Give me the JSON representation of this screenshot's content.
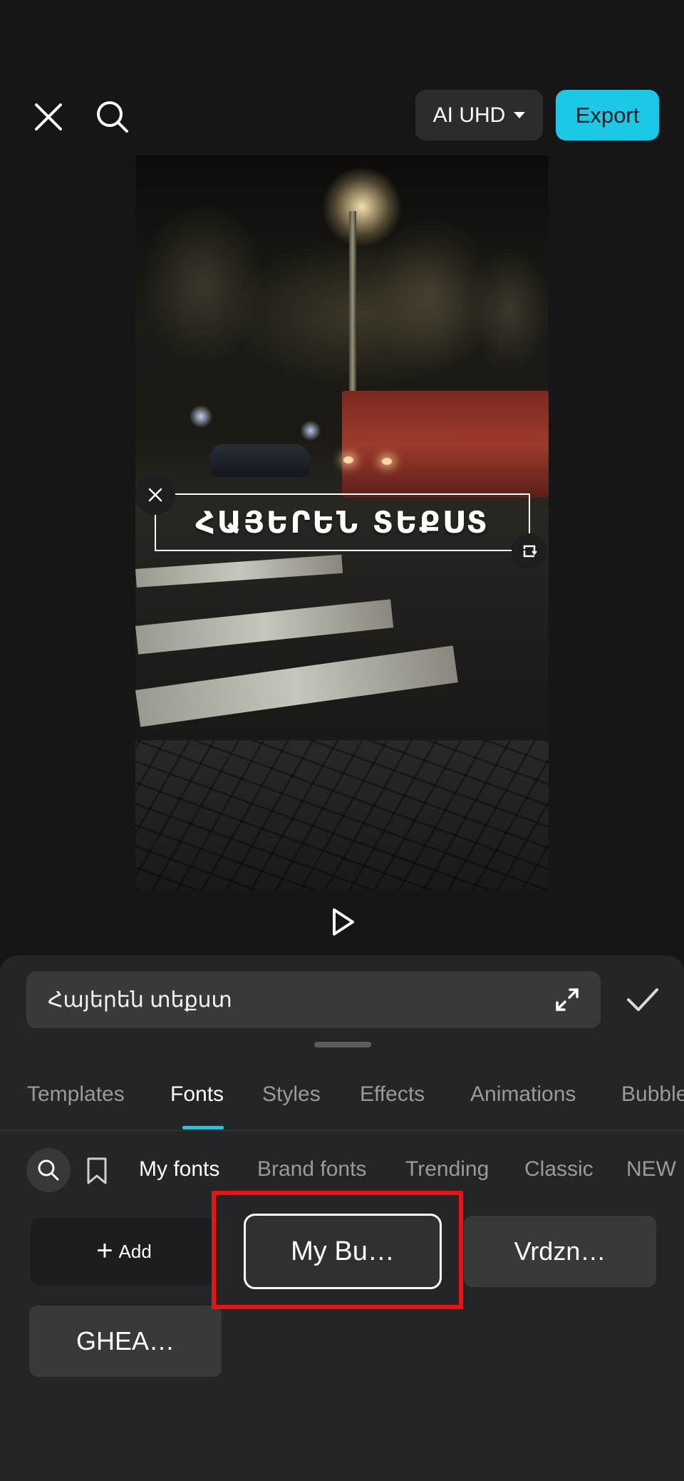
{
  "header": {
    "quality_label": "AI UHD",
    "export_label": "Export"
  },
  "preview": {
    "overlay_text": "ՀԱՅԵՐԵՆ ՏԵՔՍՏ"
  },
  "editor": {
    "text_value": "Հայերեն տեքստ"
  },
  "tabs": [
    {
      "label": "Templates"
    },
    {
      "label": "Fonts"
    },
    {
      "label": "Styles"
    },
    {
      "label": "Effects"
    },
    {
      "label": "Animations"
    },
    {
      "label": "Bubbles"
    }
  ],
  "subcategories": [
    {
      "label": "My fonts"
    },
    {
      "label": "Brand fonts"
    },
    {
      "label": "Trending"
    },
    {
      "label": "Classic"
    },
    {
      "label": "NEW"
    }
  ],
  "fonts": {
    "add_label": "Add",
    "items": [
      {
        "label": "My Bu…"
      },
      {
        "label": "Vrdzn…"
      },
      {
        "label": "GHEA…"
      }
    ]
  },
  "colors": {
    "accent": "#1bc9e6",
    "highlight": "#ee1111"
  }
}
